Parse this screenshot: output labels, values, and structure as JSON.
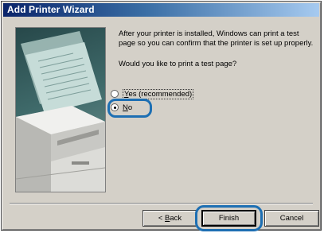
{
  "window": {
    "title": "Add Printer Wizard"
  },
  "content": {
    "description": "After your printer is installed, Windows can print a test page so you can confirm that the printer is set up properly.",
    "question": "Would you like to print a test page?"
  },
  "options": [
    {
      "label": "Yes (recommended)",
      "accel": "Y",
      "rest": "es (recommended)",
      "selected": false
    },
    {
      "label": "No",
      "accel": "N",
      "rest": "o",
      "selected": true
    }
  ],
  "buttons": {
    "back": {
      "label": "< Back",
      "prefix": "< ",
      "accel": "B",
      "rest": "ack"
    },
    "finish": {
      "label": "Finish"
    },
    "cancel": {
      "label": "Cancel"
    }
  },
  "colors": {
    "titlebar_start": "#0a246a",
    "titlebar_end": "#a6caf0",
    "dialog_face": "#d4d0c8",
    "highlight_ring": "#1d6fb3"
  },
  "icons": {
    "wizard_picture": "printer-illustration",
    "radio": "radio-button"
  }
}
